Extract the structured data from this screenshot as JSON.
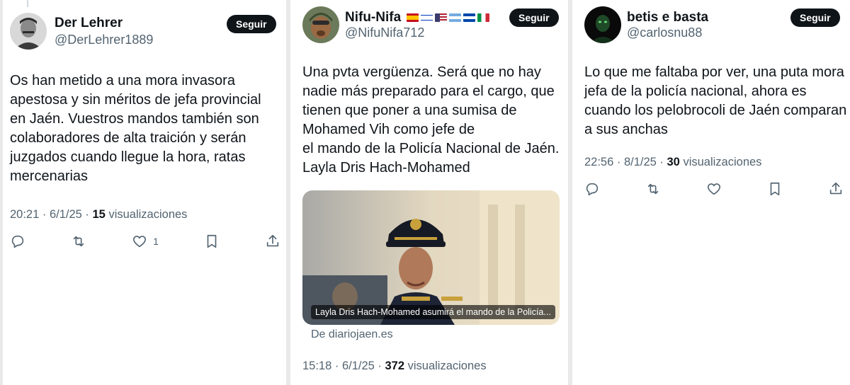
{
  "tweets": [
    {
      "name": "Der Lehrer",
      "handle": "@DerLehrer1889",
      "follow_label": "Seguir",
      "text_lines": [
        "Os han metido a una mora invasora",
        "apestosa y sin méritos de jefa provincial",
        "en Jaén. Vuestros mandos también son",
        "colaboradores de alta traición y serán",
        "juzgados cuando llegue la hora, ratas",
        "mercenarias"
      ],
      "time": "20:21 · 6/1/25 · ",
      "views": "15",
      "views_label": " visualizaciones",
      "like_count": "1"
    },
    {
      "name": "Nifu-Nifa",
      "handle": "@NifuNifa712",
      "follow_label": "Seguir",
      "text_lines": [
        "Una pvta vergüenza. Será que no hay",
        "nadie más preparado para el cargo, que",
        "tienen que poner a una sumisa de",
        "Mohamed Vih como jefe de",
        "el mando de la Policía Nacional de Jaén.",
        "Layla Dris Hach-Mohamed"
      ],
      "card_caption": "Layla Dris Hach-Mohamed asumirá el mando de la Policía...",
      "card_source": "De diariojaen.es",
      "time": "15:18 · 6/1/25 · ",
      "views": "372",
      "views_label": " visualizaciones"
    },
    {
      "name": "betis e basta",
      "handle": "@carlosnu88",
      "follow_label": "Seguir",
      "text_lines": [
        "Lo que me faltaba por ver, una puta mora",
        "jefa de la policía nacional, ahora es",
        "cuando los pelobrocoli de Jaén comparan",
        "a sus anchas"
      ],
      "time": "22:56 · 8/1/25 · ",
      "views": "30",
      "views_label": " visualizaciones"
    }
  ],
  "icons": [
    "reply-icon",
    "retweet-icon",
    "like-icon",
    "bookmark-icon",
    "share-icon"
  ],
  "colors": {
    "follow_bg": "#0f1419",
    "muted": "#536471",
    "text": "#0f1419"
  }
}
